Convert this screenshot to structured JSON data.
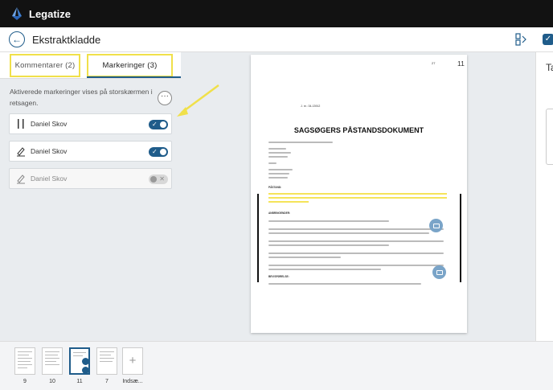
{
  "app": {
    "name": "Legatize"
  },
  "header": {
    "title": "Ekstraktkladde"
  },
  "tabs": [
    {
      "label": "Kommentarer (2)"
    },
    {
      "label": "Markeringer (3)"
    }
  ],
  "panel": {
    "info_text": "Aktiverede markeringer vises på storskærmen i retsagen.",
    "more_label": "···"
  },
  "markings": [
    {
      "name": "Daniel Skov",
      "icon": "double-bar-icon",
      "enabled": true
    },
    {
      "name": "Daniel Skov",
      "icon": "highlighter-pen-icon",
      "enabled": true
    },
    {
      "name": "Daniel Skov",
      "icon": "highlighter-pen-icon",
      "enabled": false
    }
  ],
  "document": {
    "page_number": "11",
    "top_number": "27",
    "j_nr": "J. nr.: 34-13912",
    "title": "SAGSØGERS PÅSTANDSDOKUMENT",
    "section_pastand": "PÅSTAND:",
    "section_anbringender": "ANBRINGENDER:",
    "section_bevisforelse": "BEVISFØRELSE:"
  },
  "right_panel": {
    "text": "Ta"
  },
  "thumbnails": [
    {
      "label": "9",
      "selected": false
    },
    {
      "label": "10",
      "selected": false
    },
    {
      "label": "11",
      "selected": true
    },
    {
      "label": "7",
      "selected": false
    }
  ],
  "insert_label": "Indsæ...",
  "colors": {
    "accent": "#1f5c8a",
    "highlight": "#f0e04a",
    "topbar": "#121212"
  }
}
